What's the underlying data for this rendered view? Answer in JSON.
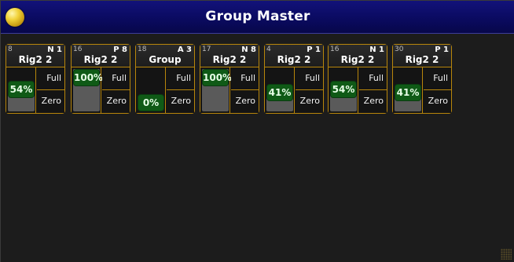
{
  "window": {
    "title": "Group Master",
    "icon": "yellow-ball-icon"
  },
  "colors": {
    "titlebar": "#0a0a5e",
    "accent": "#b8860b",
    "value_green": "#0f5a16"
  },
  "faders": [
    {
      "id": "8",
      "tag": "N 1",
      "name": "Rig2 2",
      "value": "54%",
      "level": 0.54,
      "full_label": "Full",
      "zero_label": "Zero"
    },
    {
      "id": "16",
      "tag": "P 8",
      "name": "Rig2 2",
      "value": "100%",
      "level": 1.0,
      "full_label": "Full",
      "zero_label": "Zero"
    },
    {
      "id": "18",
      "tag": "A 3",
      "name": "Group",
      "value": "0%",
      "level": 0.0,
      "full_label": "Full",
      "zero_label": "Zero"
    },
    {
      "id": "17",
      "tag": "N 8",
      "name": "Rig2 2",
      "value": "100%",
      "level": 1.0,
      "full_label": "Full",
      "zero_label": "Zero"
    },
    {
      "id": "4",
      "tag": "P 1",
      "name": "Rig2 2",
      "value": "41%",
      "level": 0.41,
      "full_label": "Full",
      "zero_label": "Zero"
    },
    {
      "id": "16",
      "tag": "N 1",
      "name": "Rig2 2",
      "value": "54%",
      "level": 0.54,
      "full_label": "Full",
      "zero_label": "Zero"
    },
    {
      "id": "30",
      "tag": "P 1",
      "name": "Rig2 2",
      "value": "41%",
      "level": 0.41,
      "full_label": "Full",
      "zero_label": "Zero"
    }
  ]
}
